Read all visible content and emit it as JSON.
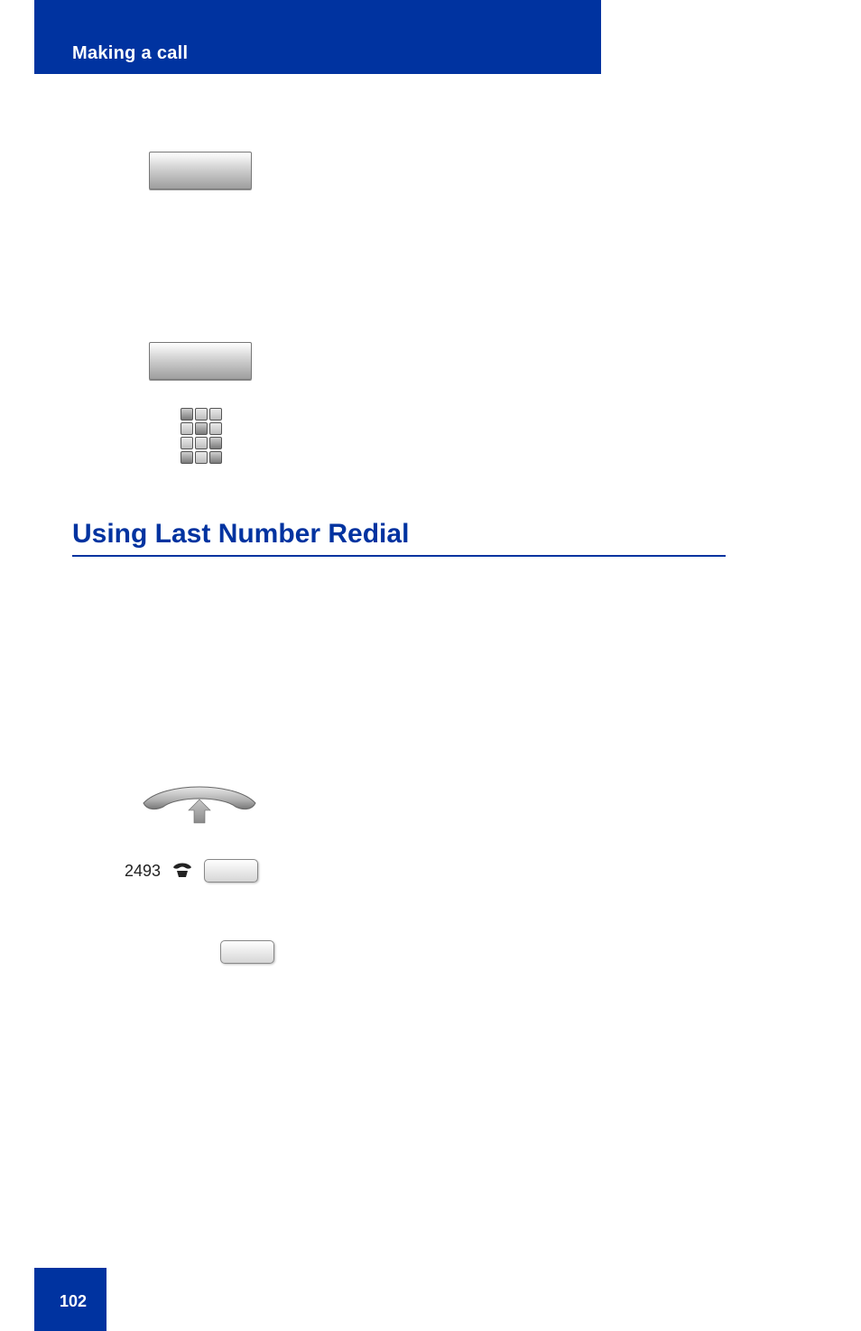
{
  "header": {
    "title": "Making a call"
  },
  "section": {
    "heading": "Using Last Number Redial"
  },
  "line": {
    "extension": "2493"
  },
  "footer": {
    "page": "102"
  }
}
